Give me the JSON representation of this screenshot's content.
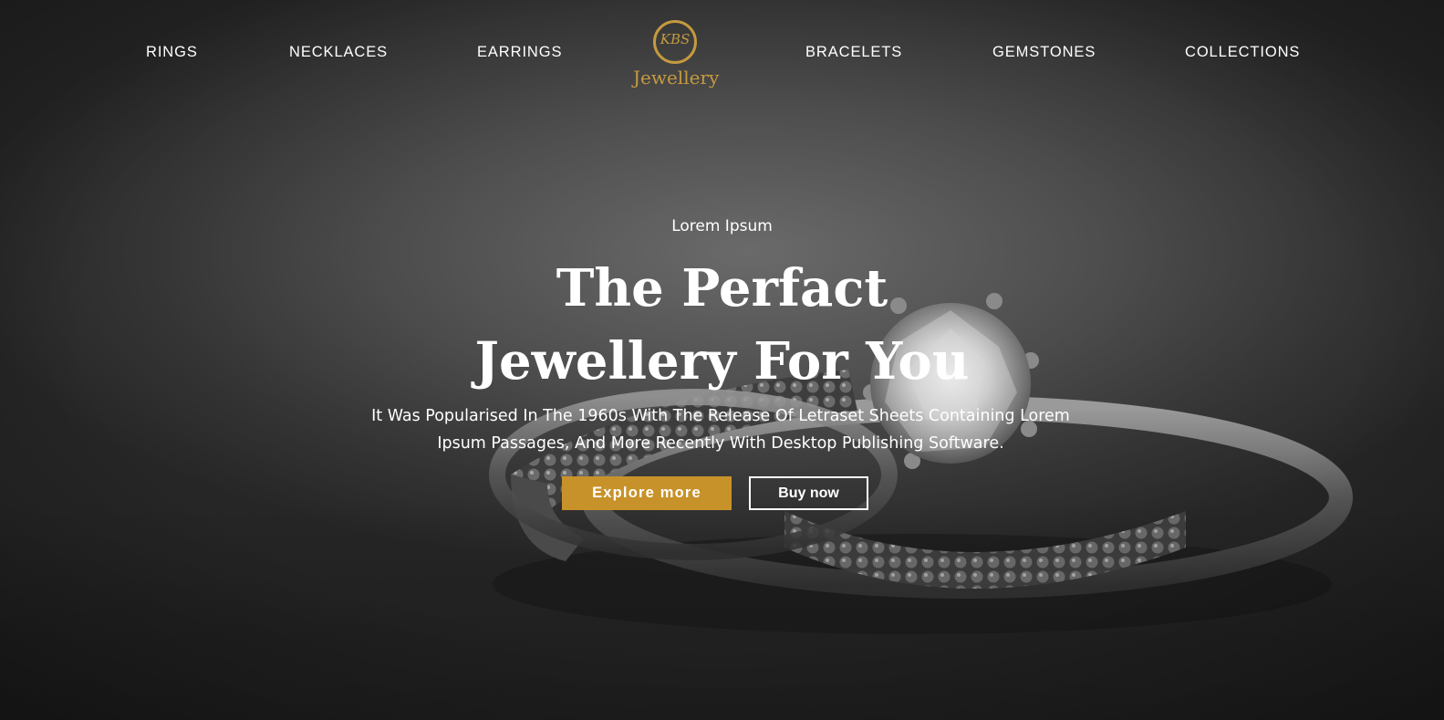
{
  "nav": {
    "items_left": [
      "RINGS",
      "NECKLACES",
      "EARRINGS"
    ],
    "items_right": [
      "BRACELETS",
      "GEMSTONES",
      "COLLECTIONS"
    ]
  },
  "logo": {
    "monogram": "KBS",
    "wordmark": "Jewellery"
  },
  "hero": {
    "kicker": "Lorem Ipsum",
    "headline_line1": "The Perfact",
    "headline_line2": "Jewellery For You",
    "description_line1": "It Was Popularised In The 1960s With The Release Of Letraset Sheets Containing Lorem",
    "description_line2": "Ipsum Passages, And More Recently With Desktop Publishing Software.",
    "primary_button": "Explore more",
    "secondary_button": "Buy now"
  },
  "colors": {
    "accent_gold": "#c8922a",
    "logo_gold": "#c59a3f",
    "text": "#ffffff",
    "background": "#3a3a3a"
  }
}
